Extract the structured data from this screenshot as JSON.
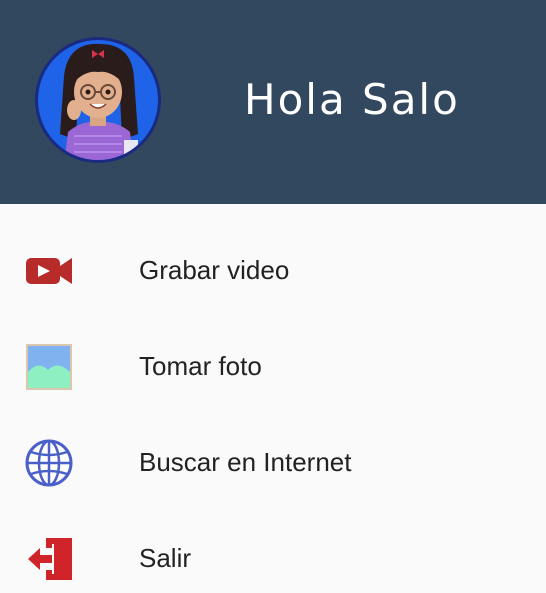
{
  "header": {
    "greeting": "Hola Salo",
    "background_color": "#31485f",
    "avatar_icon": "user-avatar-cartoon"
  },
  "menu": {
    "items": [
      {
        "label": "Grabar video",
        "icon": "video-camera-icon",
        "color": "#b72b2b"
      },
      {
        "label": "Tomar foto",
        "icon": "image-icon",
        "color": "#7ed9b0"
      },
      {
        "label": "Buscar en Internet",
        "icon": "globe-icon",
        "color": "#4a5fc8"
      },
      {
        "label": "Salir",
        "icon": "exit-icon",
        "color": "#d1232a"
      }
    ]
  }
}
